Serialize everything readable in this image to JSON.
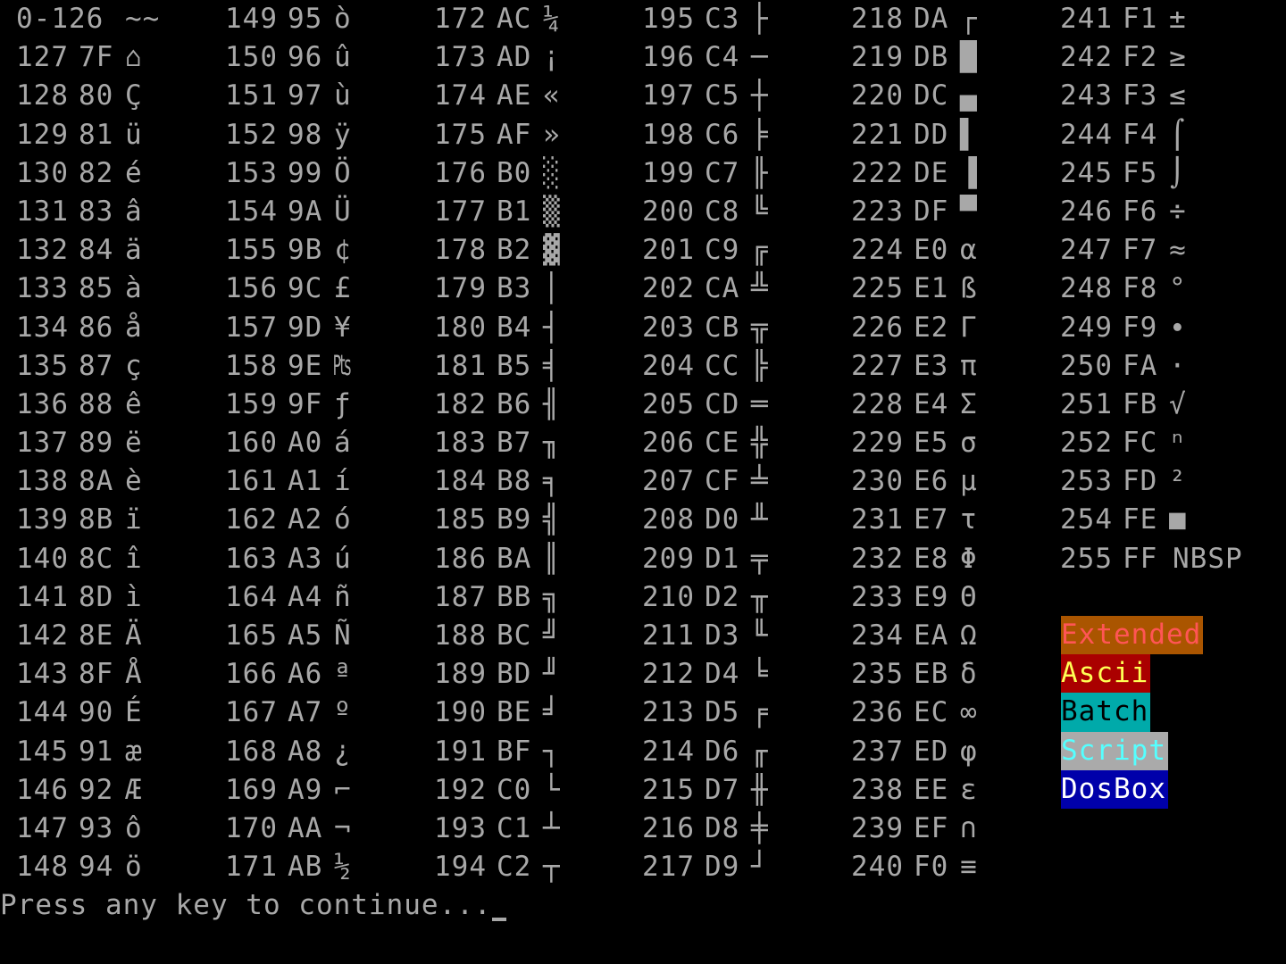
{
  "columns": [
    {
      "entries": [
        {
          "dec": "0-126",
          "hex": "",
          "glyph": "~~"
        },
        {
          "dec": "127",
          "hex": "7F",
          "glyph": "⌂"
        },
        {
          "dec": "128",
          "hex": "80",
          "glyph": "Ç"
        },
        {
          "dec": "129",
          "hex": "81",
          "glyph": "ü"
        },
        {
          "dec": "130",
          "hex": "82",
          "glyph": "é"
        },
        {
          "dec": "131",
          "hex": "83",
          "glyph": "â"
        },
        {
          "dec": "132",
          "hex": "84",
          "glyph": "ä"
        },
        {
          "dec": "133",
          "hex": "85",
          "glyph": "à"
        },
        {
          "dec": "134",
          "hex": "86",
          "glyph": "å"
        },
        {
          "dec": "135",
          "hex": "87",
          "glyph": "ç"
        },
        {
          "dec": "136",
          "hex": "88",
          "glyph": "ê"
        },
        {
          "dec": "137",
          "hex": "89",
          "glyph": "ë"
        },
        {
          "dec": "138",
          "hex": "8A",
          "glyph": "è"
        },
        {
          "dec": "139",
          "hex": "8B",
          "glyph": "ï"
        },
        {
          "dec": "140",
          "hex": "8C",
          "glyph": "î"
        },
        {
          "dec": "141",
          "hex": "8D",
          "glyph": "ì"
        },
        {
          "dec": "142",
          "hex": "8E",
          "glyph": "Ä"
        },
        {
          "dec": "143",
          "hex": "8F",
          "glyph": "Å"
        },
        {
          "dec": "144",
          "hex": "90",
          "glyph": "É"
        },
        {
          "dec": "145",
          "hex": "91",
          "glyph": "æ"
        },
        {
          "dec": "146",
          "hex": "92",
          "glyph": "Æ"
        },
        {
          "dec": "147",
          "hex": "93",
          "glyph": "ô"
        },
        {
          "dec": "148",
          "hex": "94",
          "glyph": "ö"
        }
      ]
    },
    {
      "entries": [
        {
          "dec": "149",
          "hex": "95",
          "glyph": "ò"
        },
        {
          "dec": "150",
          "hex": "96",
          "glyph": "û"
        },
        {
          "dec": "151",
          "hex": "97",
          "glyph": "ù"
        },
        {
          "dec": "152",
          "hex": "98",
          "glyph": "ÿ"
        },
        {
          "dec": "153",
          "hex": "99",
          "glyph": "Ö"
        },
        {
          "dec": "154",
          "hex": "9A",
          "glyph": "Ü"
        },
        {
          "dec": "155",
          "hex": "9B",
          "glyph": "¢"
        },
        {
          "dec": "156",
          "hex": "9C",
          "glyph": "£"
        },
        {
          "dec": "157",
          "hex": "9D",
          "glyph": "¥"
        },
        {
          "dec": "158",
          "hex": "9E",
          "glyph": "₧"
        },
        {
          "dec": "159",
          "hex": "9F",
          "glyph": "ƒ"
        },
        {
          "dec": "160",
          "hex": "A0",
          "glyph": "á"
        },
        {
          "dec": "161",
          "hex": "A1",
          "glyph": "í"
        },
        {
          "dec": "162",
          "hex": "A2",
          "glyph": "ó"
        },
        {
          "dec": "163",
          "hex": "A3",
          "glyph": "ú"
        },
        {
          "dec": "164",
          "hex": "A4",
          "glyph": "ñ"
        },
        {
          "dec": "165",
          "hex": "A5",
          "glyph": "Ñ"
        },
        {
          "dec": "166",
          "hex": "A6",
          "glyph": "ª"
        },
        {
          "dec": "167",
          "hex": "A7",
          "glyph": "º"
        },
        {
          "dec": "168",
          "hex": "A8",
          "glyph": "¿"
        },
        {
          "dec": "169",
          "hex": "A9",
          "glyph": "⌐"
        },
        {
          "dec": "170",
          "hex": "AA",
          "glyph": "¬"
        },
        {
          "dec": "171",
          "hex": "AB",
          "glyph": "½"
        }
      ]
    },
    {
      "entries": [
        {
          "dec": "172",
          "hex": "AC",
          "glyph": "¼"
        },
        {
          "dec": "173",
          "hex": "AD",
          "glyph": "¡"
        },
        {
          "dec": "174",
          "hex": "AE",
          "glyph": "«"
        },
        {
          "dec": "175",
          "hex": "AF",
          "glyph": "»"
        },
        {
          "dec": "176",
          "hex": "B0",
          "glyph": "░"
        },
        {
          "dec": "177",
          "hex": "B1",
          "glyph": "▒"
        },
        {
          "dec": "178",
          "hex": "B2",
          "glyph": "▓"
        },
        {
          "dec": "179",
          "hex": "B3",
          "glyph": "│"
        },
        {
          "dec": "180",
          "hex": "B4",
          "glyph": "┤"
        },
        {
          "dec": "181",
          "hex": "B5",
          "glyph": "╡"
        },
        {
          "dec": "182",
          "hex": "B6",
          "glyph": "╢"
        },
        {
          "dec": "183",
          "hex": "B7",
          "glyph": "╖"
        },
        {
          "dec": "184",
          "hex": "B8",
          "glyph": "╕"
        },
        {
          "dec": "185",
          "hex": "B9",
          "glyph": "╣"
        },
        {
          "dec": "186",
          "hex": "BA",
          "glyph": "║"
        },
        {
          "dec": "187",
          "hex": "BB",
          "glyph": "╗"
        },
        {
          "dec": "188",
          "hex": "BC",
          "glyph": "╝"
        },
        {
          "dec": "189",
          "hex": "BD",
          "glyph": "╜"
        },
        {
          "dec": "190",
          "hex": "BE",
          "glyph": "╛"
        },
        {
          "dec": "191",
          "hex": "BF",
          "glyph": "┐"
        },
        {
          "dec": "192",
          "hex": "C0",
          "glyph": "└"
        },
        {
          "dec": "193",
          "hex": "C1",
          "glyph": "┴"
        },
        {
          "dec": "194",
          "hex": "C2",
          "glyph": "┬"
        }
      ]
    },
    {
      "entries": [
        {
          "dec": "195",
          "hex": "C3",
          "glyph": "├"
        },
        {
          "dec": "196",
          "hex": "C4",
          "glyph": "─"
        },
        {
          "dec": "197",
          "hex": "C5",
          "glyph": "┼"
        },
        {
          "dec": "198",
          "hex": "C6",
          "glyph": "╞"
        },
        {
          "dec": "199",
          "hex": "C7",
          "glyph": "╟"
        },
        {
          "dec": "200",
          "hex": "C8",
          "glyph": "╚"
        },
        {
          "dec": "201",
          "hex": "C9",
          "glyph": "╔"
        },
        {
          "dec": "202",
          "hex": "CA",
          "glyph": "╩"
        },
        {
          "dec": "203",
          "hex": "CB",
          "glyph": "╦"
        },
        {
          "dec": "204",
          "hex": "CC",
          "glyph": "╠"
        },
        {
          "dec": "205",
          "hex": "CD",
          "glyph": "═"
        },
        {
          "dec": "206",
          "hex": "CE",
          "glyph": "╬"
        },
        {
          "dec": "207",
          "hex": "CF",
          "glyph": "╧"
        },
        {
          "dec": "208",
          "hex": "D0",
          "glyph": "╨"
        },
        {
          "dec": "209",
          "hex": "D1",
          "glyph": "╤"
        },
        {
          "dec": "210",
          "hex": "D2",
          "glyph": "╥"
        },
        {
          "dec": "211",
          "hex": "D3",
          "glyph": "╙"
        },
        {
          "dec": "212",
          "hex": "D4",
          "glyph": "╘"
        },
        {
          "dec": "213",
          "hex": "D5",
          "glyph": "╒"
        },
        {
          "dec": "214",
          "hex": "D6",
          "glyph": "╓"
        },
        {
          "dec": "215",
          "hex": "D7",
          "glyph": "╫"
        },
        {
          "dec": "216",
          "hex": "D8",
          "glyph": "╪"
        },
        {
          "dec": "217",
          "hex": "D9",
          "glyph": "┘"
        }
      ]
    },
    {
      "entries": [
        {
          "dec": "218",
          "hex": "DA",
          "glyph": "┌"
        },
        {
          "dec": "219",
          "hex": "DB",
          "glyph": "█"
        },
        {
          "dec": "220",
          "hex": "DC",
          "glyph": "▄"
        },
        {
          "dec": "221",
          "hex": "DD",
          "glyph": "▌"
        },
        {
          "dec": "222",
          "hex": "DE",
          "glyph": "▐"
        },
        {
          "dec": "223",
          "hex": "DF",
          "glyph": "▀"
        },
        {
          "dec": "224",
          "hex": "E0",
          "glyph": "α"
        },
        {
          "dec": "225",
          "hex": "E1",
          "glyph": "ß"
        },
        {
          "dec": "226",
          "hex": "E2",
          "glyph": "Γ"
        },
        {
          "dec": "227",
          "hex": "E3",
          "glyph": "π"
        },
        {
          "dec": "228",
          "hex": "E4",
          "glyph": "Σ"
        },
        {
          "dec": "229",
          "hex": "E5",
          "glyph": "σ"
        },
        {
          "dec": "230",
          "hex": "E6",
          "glyph": "µ"
        },
        {
          "dec": "231",
          "hex": "E7",
          "glyph": "τ"
        },
        {
          "dec": "232",
          "hex": "E8",
          "glyph": "Φ"
        },
        {
          "dec": "233",
          "hex": "E9",
          "glyph": "Θ"
        },
        {
          "dec": "234",
          "hex": "EA",
          "glyph": "Ω"
        },
        {
          "dec": "235",
          "hex": "EB",
          "glyph": "δ"
        },
        {
          "dec": "236",
          "hex": "EC",
          "glyph": "∞"
        },
        {
          "dec": "237",
          "hex": "ED",
          "glyph": "φ"
        },
        {
          "dec": "238",
          "hex": "EE",
          "glyph": "ε"
        },
        {
          "dec": "239",
          "hex": "EF",
          "glyph": "∩"
        },
        {
          "dec": "240",
          "hex": "F0",
          "glyph": "≡"
        }
      ]
    },
    {
      "entries": [
        {
          "dec": "241",
          "hex": "F1",
          "glyph": "±"
        },
        {
          "dec": "242",
          "hex": "F2",
          "glyph": "≥"
        },
        {
          "dec": "243",
          "hex": "F3",
          "glyph": "≤"
        },
        {
          "dec": "244",
          "hex": "F4",
          "glyph": "⌠"
        },
        {
          "dec": "245",
          "hex": "F5",
          "glyph": "⌡"
        },
        {
          "dec": "246",
          "hex": "F6",
          "glyph": "÷"
        },
        {
          "dec": "247",
          "hex": "F7",
          "glyph": "≈"
        },
        {
          "dec": "248",
          "hex": "F8",
          "glyph": "°"
        },
        {
          "dec": "249",
          "hex": "F9",
          "glyph": "∙"
        },
        {
          "dec": "250",
          "hex": "FA",
          "glyph": "·"
        },
        {
          "dec": "251",
          "hex": "FB",
          "glyph": "√"
        },
        {
          "dec": "252",
          "hex": "FC",
          "glyph": "ⁿ"
        },
        {
          "dec": "253",
          "hex": "FD",
          "glyph": "²"
        },
        {
          "dec": "254",
          "hex": "FE",
          "glyph": "■"
        },
        {
          "dec": "255",
          "hex": "FF",
          "glyph": "NBSP"
        }
      ]
    }
  ],
  "legend": [
    {
      "label": "Extended",
      "fg": "#ff5555",
      "bg": "#aa5500"
    },
    {
      "label": "Ascii",
      "fg": "#ffff55",
      "bg": "#aa0000"
    },
    {
      "label": "Batch",
      "fg": "#000000",
      "bg": "#00aaaa"
    },
    {
      "label": "Script",
      "fg": "#55ffff",
      "bg": "#aaaaaa"
    },
    {
      "label": "DosBox",
      "fg": "#ffffff",
      "bg": "#0000aa"
    }
  ],
  "prompt": "Press any key to continue...",
  "colors": {
    "background": "#000000",
    "text": "#a8a8a8"
  }
}
